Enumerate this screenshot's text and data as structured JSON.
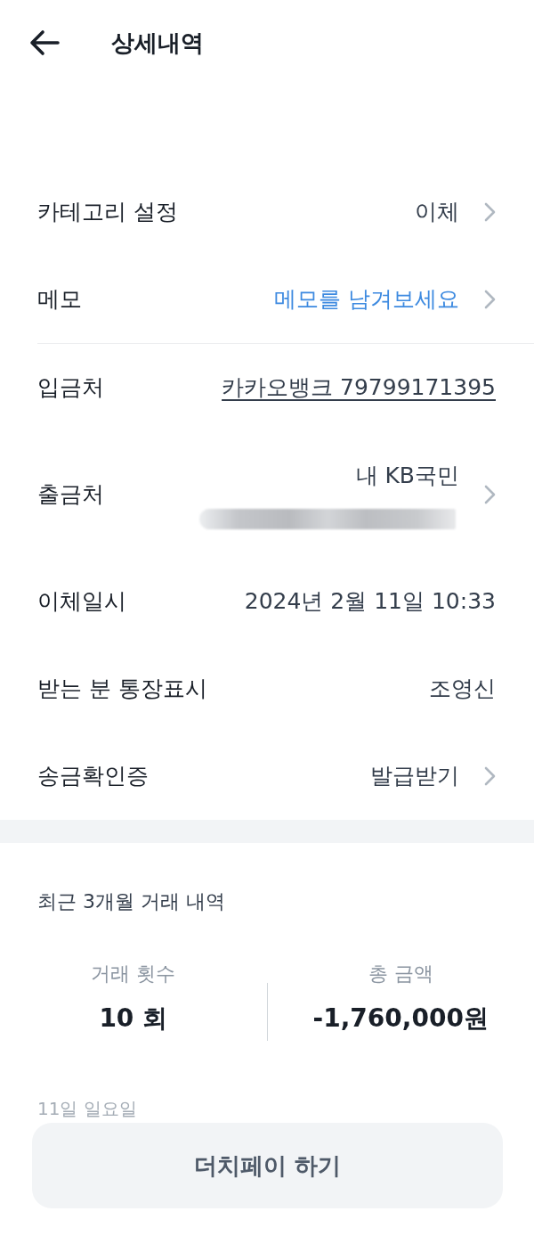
{
  "header": {
    "title": "상세내역"
  },
  "settings": [
    {
      "kind": "nav",
      "label": "카테고리 설정",
      "value": "이체"
    },
    {
      "kind": "prompt",
      "label": "메모",
      "value": "메모를 남겨보세요"
    }
  ],
  "details": [
    {
      "kind": "link",
      "label": "입금처",
      "value": "카카오뱅크 79799171395"
    },
    {
      "kind": "account",
      "label": "출금처",
      "value": "내 KB국민",
      "masked": true
    },
    {
      "kind": "plain",
      "label": "이체일시",
      "value": "2024년 2월 11일 10:33"
    },
    {
      "kind": "plain",
      "label": "받는 분 통장표시",
      "value": "조영신"
    },
    {
      "kind": "nav",
      "label": "송금확인증",
      "value": "발급받기"
    }
  ],
  "summary": {
    "title": "최근 3개월 거래 내역",
    "stats": [
      {
        "label": "거래 횟수",
        "value": "10 회"
      },
      {
        "label": "총 금액",
        "value": "-1,760,000원"
      }
    ]
  },
  "faded_text": "11일 일요일",
  "action_button": {
    "label": "더치페이 하기"
  }
}
